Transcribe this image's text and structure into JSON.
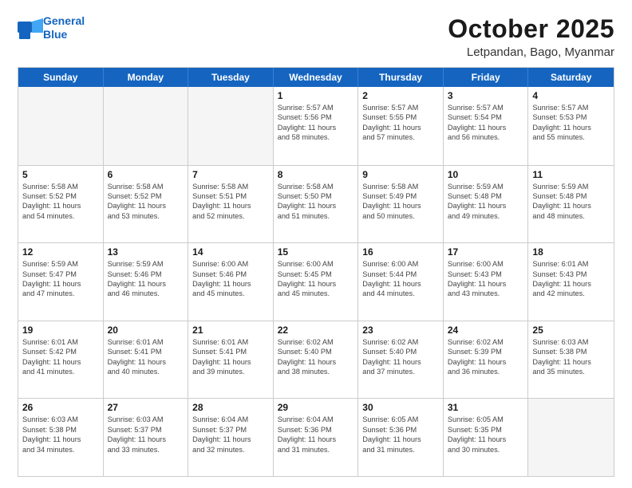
{
  "logo": {
    "line1": "General",
    "line2": "Blue"
  },
  "title": "October 2025",
  "location": "Letpandan, Bago, Myanmar",
  "header": {
    "days": [
      "Sunday",
      "Monday",
      "Tuesday",
      "Wednesday",
      "Thursday",
      "Friday",
      "Saturday"
    ]
  },
  "weeks": [
    [
      {
        "day": "",
        "empty": true
      },
      {
        "day": "",
        "empty": true
      },
      {
        "day": "",
        "empty": true
      },
      {
        "day": "1",
        "text": "Sunrise: 5:57 AM\nSunset: 5:56 PM\nDaylight: 11 hours\nand 58 minutes."
      },
      {
        "day": "2",
        "text": "Sunrise: 5:57 AM\nSunset: 5:55 PM\nDaylight: 11 hours\nand 57 minutes."
      },
      {
        "day": "3",
        "text": "Sunrise: 5:57 AM\nSunset: 5:54 PM\nDaylight: 11 hours\nand 56 minutes."
      },
      {
        "day": "4",
        "text": "Sunrise: 5:57 AM\nSunset: 5:53 PM\nDaylight: 11 hours\nand 55 minutes."
      }
    ],
    [
      {
        "day": "5",
        "text": "Sunrise: 5:58 AM\nSunset: 5:52 PM\nDaylight: 11 hours\nand 54 minutes."
      },
      {
        "day": "6",
        "text": "Sunrise: 5:58 AM\nSunset: 5:52 PM\nDaylight: 11 hours\nand 53 minutes."
      },
      {
        "day": "7",
        "text": "Sunrise: 5:58 AM\nSunset: 5:51 PM\nDaylight: 11 hours\nand 52 minutes."
      },
      {
        "day": "8",
        "text": "Sunrise: 5:58 AM\nSunset: 5:50 PM\nDaylight: 11 hours\nand 51 minutes."
      },
      {
        "day": "9",
        "text": "Sunrise: 5:58 AM\nSunset: 5:49 PM\nDaylight: 11 hours\nand 50 minutes."
      },
      {
        "day": "10",
        "text": "Sunrise: 5:59 AM\nSunset: 5:48 PM\nDaylight: 11 hours\nand 49 minutes."
      },
      {
        "day": "11",
        "text": "Sunrise: 5:59 AM\nSunset: 5:48 PM\nDaylight: 11 hours\nand 48 minutes."
      }
    ],
    [
      {
        "day": "12",
        "text": "Sunrise: 5:59 AM\nSunset: 5:47 PM\nDaylight: 11 hours\nand 47 minutes."
      },
      {
        "day": "13",
        "text": "Sunrise: 5:59 AM\nSunset: 5:46 PM\nDaylight: 11 hours\nand 46 minutes."
      },
      {
        "day": "14",
        "text": "Sunrise: 6:00 AM\nSunset: 5:46 PM\nDaylight: 11 hours\nand 45 minutes."
      },
      {
        "day": "15",
        "text": "Sunrise: 6:00 AM\nSunset: 5:45 PM\nDaylight: 11 hours\nand 45 minutes."
      },
      {
        "day": "16",
        "text": "Sunrise: 6:00 AM\nSunset: 5:44 PM\nDaylight: 11 hours\nand 44 minutes."
      },
      {
        "day": "17",
        "text": "Sunrise: 6:00 AM\nSunset: 5:43 PM\nDaylight: 11 hours\nand 43 minutes."
      },
      {
        "day": "18",
        "text": "Sunrise: 6:01 AM\nSunset: 5:43 PM\nDaylight: 11 hours\nand 42 minutes."
      }
    ],
    [
      {
        "day": "19",
        "text": "Sunrise: 6:01 AM\nSunset: 5:42 PM\nDaylight: 11 hours\nand 41 minutes."
      },
      {
        "day": "20",
        "text": "Sunrise: 6:01 AM\nSunset: 5:41 PM\nDaylight: 11 hours\nand 40 minutes."
      },
      {
        "day": "21",
        "text": "Sunrise: 6:01 AM\nSunset: 5:41 PM\nDaylight: 11 hours\nand 39 minutes."
      },
      {
        "day": "22",
        "text": "Sunrise: 6:02 AM\nSunset: 5:40 PM\nDaylight: 11 hours\nand 38 minutes."
      },
      {
        "day": "23",
        "text": "Sunrise: 6:02 AM\nSunset: 5:40 PM\nDaylight: 11 hours\nand 37 minutes."
      },
      {
        "day": "24",
        "text": "Sunrise: 6:02 AM\nSunset: 5:39 PM\nDaylight: 11 hours\nand 36 minutes."
      },
      {
        "day": "25",
        "text": "Sunrise: 6:03 AM\nSunset: 5:38 PM\nDaylight: 11 hours\nand 35 minutes."
      }
    ],
    [
      {
        "day": "26",
        "text": "Sunrise: 6:03 AM\nSunset: 5:38 PM\nDaylight: 11 hours\nand 34 minutes."
      },
      {
        "day": "27",
        "text": "Sunrise: 6:03 AM\nSunset: 5:37 PM\nDaylight: 11 hours\nand 33 minutes."
      },
      {
        "day": "28",
        "text": "Sunrise: 6:04 AM\nSunset: 5:37 PM\nDaylight: 11 hours\nand 32 minutes."
      },
      {
        "day": "29",
        "text": "Sunrise: 6:04 AM\nSunset: 5:36 PM\nDaylight: 11 hours\nand 31 minutes."
      },
      {
        "day": "30",
        "text": "Sunrise: 6:05 AM\nSunset: 5:36 PM\nDaylight: 11 hours\nand 31 minutes."
      },
      {
        "day": "31",
        "text": "Sunrise: 6:05 AM\nSunset: 5:35 PM\nDaylight: 11 hours\nand 30 minutes."
      },
      {
        "day": "",
        "empty": true
      }
    ]
  ]
}
